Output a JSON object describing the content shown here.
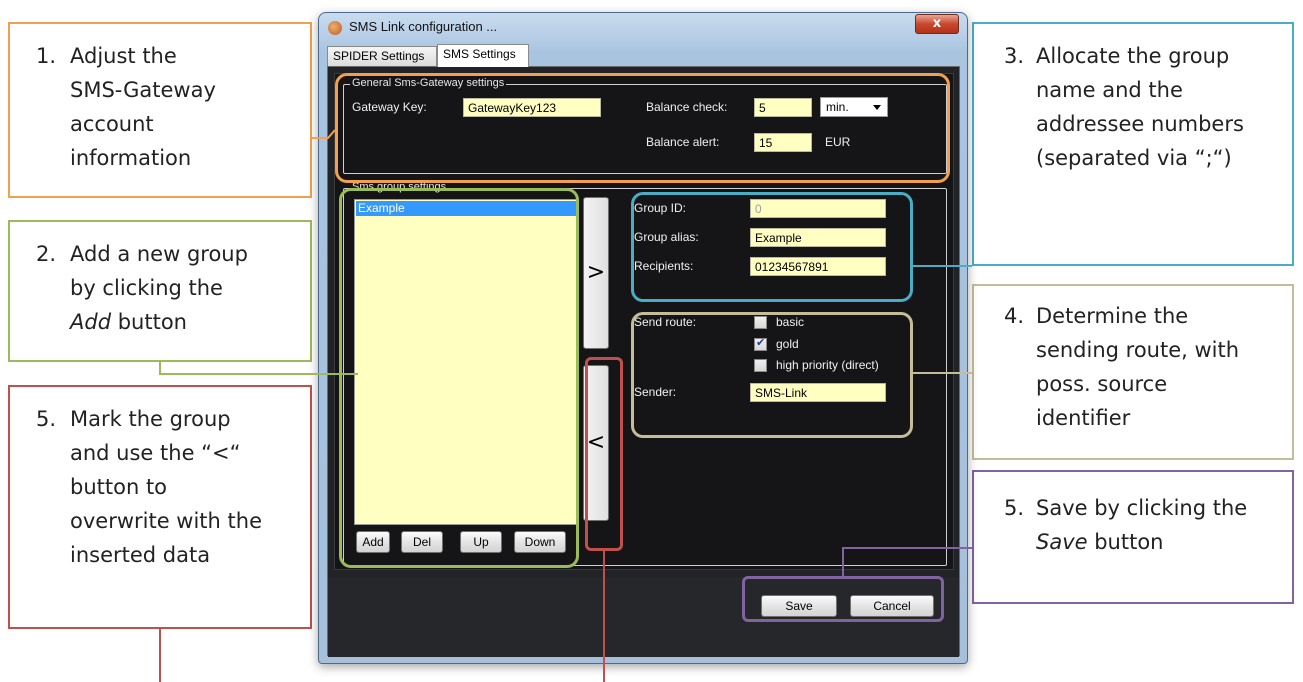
{
  "colors": {
    "orange": "#f2a04f",
    "green": "#9bbb59",
    "blue": "#4bacc6",
    "tan": "#c4bd97",
    "red": "#c0504d",
    "purple": "#8064a2"
  },
  "callouts": {
    "c1": {
      "num": "1.",
      "lines": [
        "Adjust the",
        "SMS-Gateway",
        "account",
        "information"
      ]
    },
    "c2": {
      "num": "2.",
      "lines": [
        "Add a new group",
        "by clicking the",
        "Add",
        " button"
      ]
    },
    "c3": {
      "num": "3.",
      "lines": [
        "Allocate the group",
        "name and the",
        "addressee numbers",
        "(separated via  “;“)"
      ]
    },
    "c4": {
      "num": "4.",
      "lines": [
        "Determine the",
        "sending route, with",
        "poss. source",
        "identifier"
      ]
    },
    "c5a": {
      "num": "5.",
      "lines": [
        "Mark the group",
        "and use the “<“",
        "button to",
        "overwrite with the",
        "inserted data"
      ]
    },
    "c5b": {
      "num": "5.",
      "lines": [
        "Save by clicking the",
        "Save",
        " button"
      ]
    }
  },
  "window": {
    "title": "SMS Link configuration ...",
    "close_label": "x",
    "tabs": [
      {
        "label": "SPIDER Settings",
        "active": false
      },
      {
        "label": "SMS Settings",
        "active": true
      }
    ]
  },
  "gateway": {
    "group_title": "General Sms-Gateway settings",
    "key_label": "Gateway Key:",
    "key_value": "GatewayKey123",
    "balance_check_label": "Balance check:",
    "balance_check_value": "5",
    "balance_unit": "min.",
    "balance_alert_label": "Balance alert:",
    "balance_alert_value": "15",
    "currency": "EUR"
  },
  "groups": {
    "group_title": "Sms group settings",
    "list_items": [
      "Example"
    ],
    "buttons": {
      "add": "Add",
      "del": "Del",
      "up": "Up",
      "down": "Down"
    },
    "move_right_label": ">",
    "move_left_label": "<",
    "group_id_label": "Group ID:",
    "group_id_value": "0",
    "group_alias_label": "Group alias:",
    "group_alias_value": "Example",
    "recipients_label": "Recipients:",
    "recipients_value": "01234567891",
    "send_route_label": "Send route:",
    "routes": [
      {
        "label": "basic",
        "checked": false
      },
      {
        "label": "gold",
        "checked": true
      },
      {
        "label": "high priority (direct)",
        "checked": false
      }
    ],
    "sender_label": "Sender:",
    "sender_value": "SMS-Link"
  },
  "footer": {
    "save_label": "Save",
    "cancel_label": "Cancel"
  }
}
